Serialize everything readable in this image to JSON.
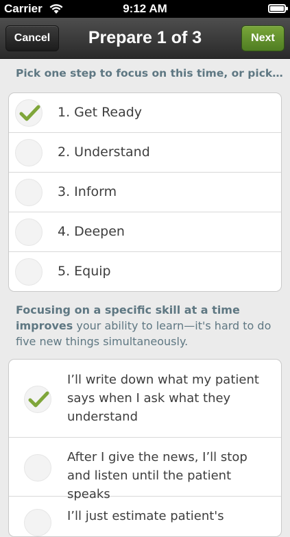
{
  "status_bar": {
    "carrier": "Carrier",
    "time": "9:12 AM"
  },
  "nav": {
    "cancel_label": "Cancel",
    "title": "Prepare 1 of 3",
    "next_label": "Next"
  },
  "instruction": "Pick one step to focus on this time, or pick a…",
  "steps": [
    {
      "label": "1. Get Ready",
      "checked": true
    },
    {
      "label": "2. Understand",
      "checked": false
    },
    {
      "label": "3. Inform",
      "checked": false
    },
    {
      "label": "4. Deepen",
      "checked": false
    },
    {
      "label": "5. Equip",
      "checked": false
    }
  ],
  "explanation": {
    "bold": "Focusing on a specific skill at a time improves",
    "rest": "your ability to learn—it's hard to do five new things simultaneously."
  },
  "commitments": [
    {
      "label": "I’ll write down what my patient says when I ask what they understand",
      "checked": true
    },
    {
      "label": "After I give the news, I’ll stop and listen until the patient speaks",
      "checked": false
    },
    {
      "label": "I’ll just estimate patient's",
      "checked": false
    }
  ],
  "colors": {
    "check_green": "#7fa63a",
    "accent_text": "#5e7782",
    "next_button": "#5f8d2b"
  },
  "icons": {
    "wifi": "wifi-icon",
    "battery": "battery-icon",
    "check": "check-icon"
  }
}
